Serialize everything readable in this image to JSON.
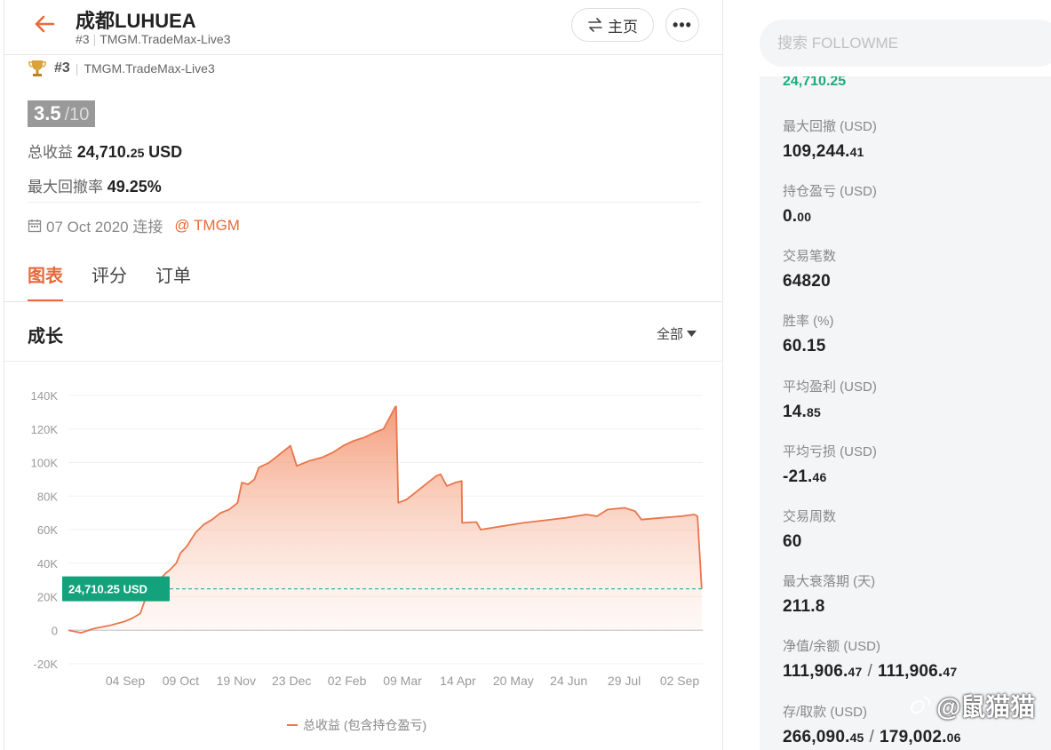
{
  "header": {
    "title": "成都LUHUEA",
    "rank": "#3",
    "server": "TMGM.TradeMax-Live3",
    "home_label": "主页"
  },
  "profile": {
    "rank": "#3",
    "server": "TMGM.TradeMax-Live3",
    "score": "3.5",
    "score_max": "/10",
    "total_profit_label": "总收益",
    "total_profit_int": "24,710.",
    "total_profit_dec": "25",
    "total_profit_unit": "USD",
    "max_drawdown_label": "最大回撤率",
    "max_drawdown_value": "49.25%",
    "connect_date": "07 Oct 2020 连接",
    "broker": "@ TMGM"
  },
  "tabs": [
    {
      "label": "图表",
      "active": true
    },
    {
      "label": "评分",
      "active": false
    },
    {
      "label": "订单",
      "active": false
    }
  ],
  "growth": {
    "title": "成长",
    "range_label": "全部"
  },
  "chart_data": {
    "type": "area",
    "y_ticks": [
      "140K",
      "120K",
      "100K",
      "80K",
      "60K",
      "40K",
      "20K",
      "0",
      "-20K"
    ],
    "y_tick_values": [
      140000,
      120000,
      100000,
      80000,
      60000,
      40000,
      20000,
      0,
      -20000
    ],
    "x_ticks": [
      "04 Sep",
      "09 Oct",
      "19 Nov",
      "23 Dec",
      "02 Feb",
      "09 Mar",
      "14 Apr",
      "20 May",
      "24 Jun",
      "29 Jul",
      "02 Sep"
    ],
    "ylim": [
      -20000,
      140000
    ],
    "current_label": "24,710.25 USD",
    "current_value": 24710.25,
    "legend": "总收益 (包含持仓盈亏)",
    "color": "#e8764a",
    "series_points": [
      [
        0,
        0
      ],
      [
        0.6,
        -1500
      ],
      [
        1.2,
        1000
      ],
      [
        2.0,
        3000
      ],
      [
        2.6,
        5000
      ],
      [
        3.0,
        7000
      ],
      [
        3.4,
        10000
      ],
      [
        3.7,
        21000
      ],
      [
        4.0,
        28000
      ],
      [
        4.3,
        30000
      ],
      [
        4.6,
        34000
      ],
      [
        4.8,
        36000
      ],
      [
        5.1,
        40000
      ],
      [
        5.3,
        46000
      ],
      [
        5.6,
        50000
      ],
      [
        6.0,
        58000
      ],
      [
        6.4,
        63000
      ],
      [
        6.8,
        66000
      ],
      [
        7.2,
        70000
      ],
      [
        7.6,
        72000
      ],
      [
        8.0,
        76000
      ],
      [
        8.2,
        88000
      ],
      [
        8.5,
        87000
      ],
      [
        8.8,
        90000
      ],
      [
        9.0,
        97000
      ],
      [
        9.5,
        100000
      ],
      [
        9.9,
        104000
      ],
      [
        10.5,
        110000
      ],
      [
        10.8,
        98000
      ],
      [
        11.4,
        101000
      ],
      [
        12.0,
        103000
      ],
      [
        12.5,
        106000
      ],
      [
        13.0,
        110000
      ],
      [
        13.5,
        113000
      ],
      [
        14.0,
        115000
      ],
      [
        14.5,
        118000
      ],
      [
        14.9,
        120000
      ],
      [
        15.2,
        127000
      ],
      [
        15.45,
        133000
      ],
      [
        15.5,
        133500
      ],
      [
        15.6,
        76000
      ],
      [
        16.0,
        78000
      ],
      [
        16.5,
        83000
      ],
      [
        17.0,
        88000
      ],
      [
        17.4,
        92000
      ],
      [
        17.6,
        93000
      ],
      [
        17.9,
        86000
      ],
      [
        18.3,
        88000
      ],
      [
        18.6,
        89000
      ],
      [
        18.62,
        64000
      ],
      [
        19.3,
        64500
      ],
      [
        19.5,
        60000
      ],
      [
        20.5,
        62000
      ],
      [
        21.5,
        64000
      ],
      [
        22.5,
        65500
      ],
      [
        23.5,
        67000
      ],
      [
        24.5,
        69000
      ],
      [
        25.0,
        68000
      ],
      [
        25.5,
        72000
      ],
      [
        26.3,
        73000
      ],
      [
        26.8,
        71000
      ],
      [
        27.1,
        66000
      ],
      [
        28.0,
        67000
      ],
      [
        29.0,
        68000
      ],
      [
        29.6,
        69000
      ],
      [
        29.75,
        68000
      ],
      [
        29.95,
        24710.25
      ]
    ],
    "x_max": 30
  },
  "search": {
    "placeholder": "搜索 FOLLOWME"
  },
  "stats": {
    "cut_value": "24,710.25",
    "items": [
      {
        "label": "最大回撤 (USD)",
        "int": "109,244.",
        "dec": "41"
      },
      {
        "label": "持仓盈亏 (USD)",
        "int": "0.",
        "dec": "00"
      },
      {
        "label": "交易笔数",
        "int": "64820",
        "dec": ""
      },
      {
        "label": "胜率 (%)",
        "int": "60.15",
        "dec": ""
      },
      {
        "label": "平均盈利 (USD)",
        "int": "14.",
        "dec": "85"
      },
      {
        "label": "平均亏损 (USD)",
        "int": "-21.",
        "dec": "46"
      },
      {
        "label": "交易周数",
        "int": "60",
        "dec": ""
      },
      {
        "label": "最大衰落期 (天)",
        "int": "211.8",
        "dec": ""
      }
    ],
    "equity": {
      "label": "净值/余额 (USD)",
      "a_int": "111,906.",
      "a_dec": "47",
      "b_int": "111,906.",
      "b_dec": "47"
    },
    "deposit": {
      "label": "存/取款 (USD)",
      "a_int": "266,090.",
      "a_dec": "45",
      "b_int": "179,002.",
      "b_dec": "06"
    }
  },
  "watermark": "@鼠猫猫"
}
